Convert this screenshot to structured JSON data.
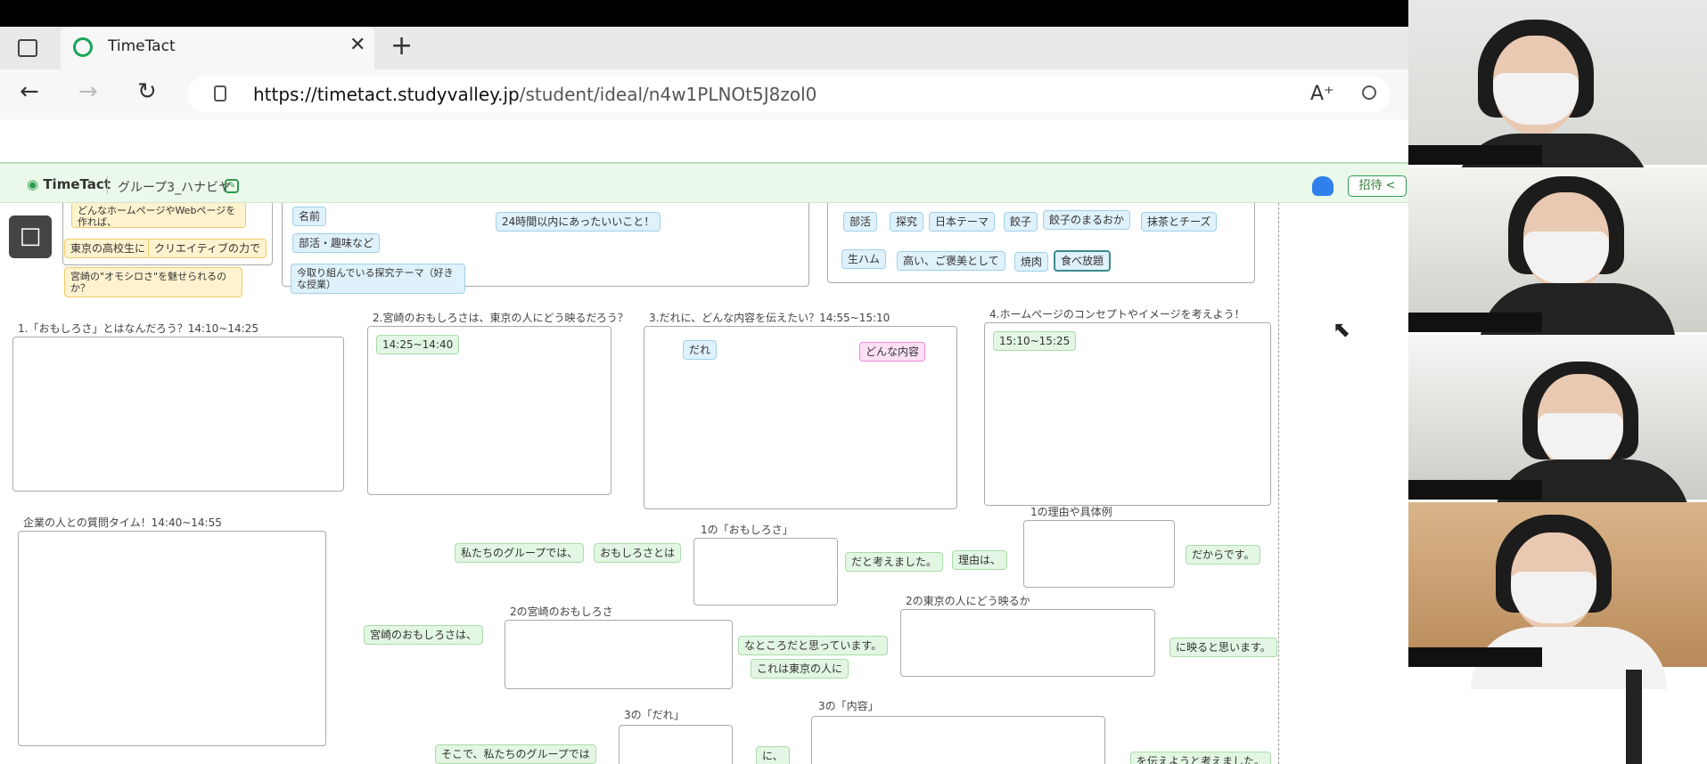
{
  "browser": {
    "tab_title": "TimeTact",
    "url_host": "https://timetact.studyvalley.jp",
    "url_path": "/student/ideal/n4w1PLNOt5J8zol0",
    "close_glyph": "✕",
    "new_tab_glyph": "+"
  },
  "app": {
    "logo": "TimeTact",
    "group_name": "グループ3_ハナビヤ",
    "invite_label": "招待"
  },
  "top_notes": {
    "yellow1": "どんなホームページやWebページを作れば、",
    "yellow2": "東京の高校生に",
    "yellow3": "クリエイティブの力で",
    "yellow4": "宮崎の\"オモシロさ\"を魅せられるのか？",
    "blue1": "名前",
    "blue2": "部活・趣味など",
    "blue3": "今取り組んでいる探究テーマ（好きな授業）",
    "blue4": "24時間以内にあったいいこと！",
    "tags": [
      "部活",
      "探究",
      "日本テーマ",
      "餃子",
      "餃子のまるおか",
      "抹茶とチーズ",
      "生ハム",
      "高い、ご褒美として",
      "焼肉",
      "食べ放題"
    ]
  },
  "sections": {
    "s1_title": "1.「おもしろさ」とはなんだろう？14:10~14:25",
    "s2_title": "2.宮崎のおもしろさは、東京の人にどう映るだろう？",
    "s2_time": "14:25~14:40",
    "s3_title": "3.だれに、どんな内容を伝えたい？14:55~15:10",
    "s3_who": "だれ",
    "s3_what": "どんな内容",
    "s4_title": "4.ホームページのコンセプトやイメージを考えよう！",
    "s4_time": "15:10~15:25",
    "qa_title": "企業の人との質問タイム！14:40~14:55"
  },
  "template": {
    "row1_a": "私たちのグループでは、",
    "row1_b": "おもしろさとは",
    "row1_box_label": "1の「おもしろさ」",
    "row1_c": "だと考えました。",
    "row1_d": "理由は、",
    "row1_box2_label": "1の理由や具体例",
    "row1_e": "だからです。",
    "row2_a": "宮崎のおもしろさは、",
    "row2_box_label": "2の宮崎のおもしろさ",
    "row2_b": "なところだと思っています。",
    "row2_c": "これは東京の人に",
    "row2_box2_label": "2の東京の人にどう映るか",
    "row2_d": "に映ると思います。",
    "row3_a": "そこで、私たちのグループでは",
    "row3_box_label": "3の「だれ」",
    "row3_b": "に、",
    "row3_box2_label": "3の「内容」",
    "row3_c": "を伝えようと考えました。"
  },
  "icons": {
    "back": "back-arrow-icon",
    "forward": "forward-arrow-icon",
    "refresh": "refresh-icon",
    "lock": "lock-icon",
    "read_aloud": "read-aloud-icon",
    "zoom": "zoom-icon",
    "frame_tool": "frame-tool-icon",
    "share": "share-icon",
    "cursor": "mouse-cursor-icon"
  },
  "colors": {
    "app_header": "#ebf9ea",
    "accent_green": "#2e9a4e",
    "sticky_blue": "#dff1fb",
    "sticky_green": "#e3f6e3",
    "sticky_yellow": "#fff3cf",
    "sticky_pink": "#fde0f4"
  }
}
